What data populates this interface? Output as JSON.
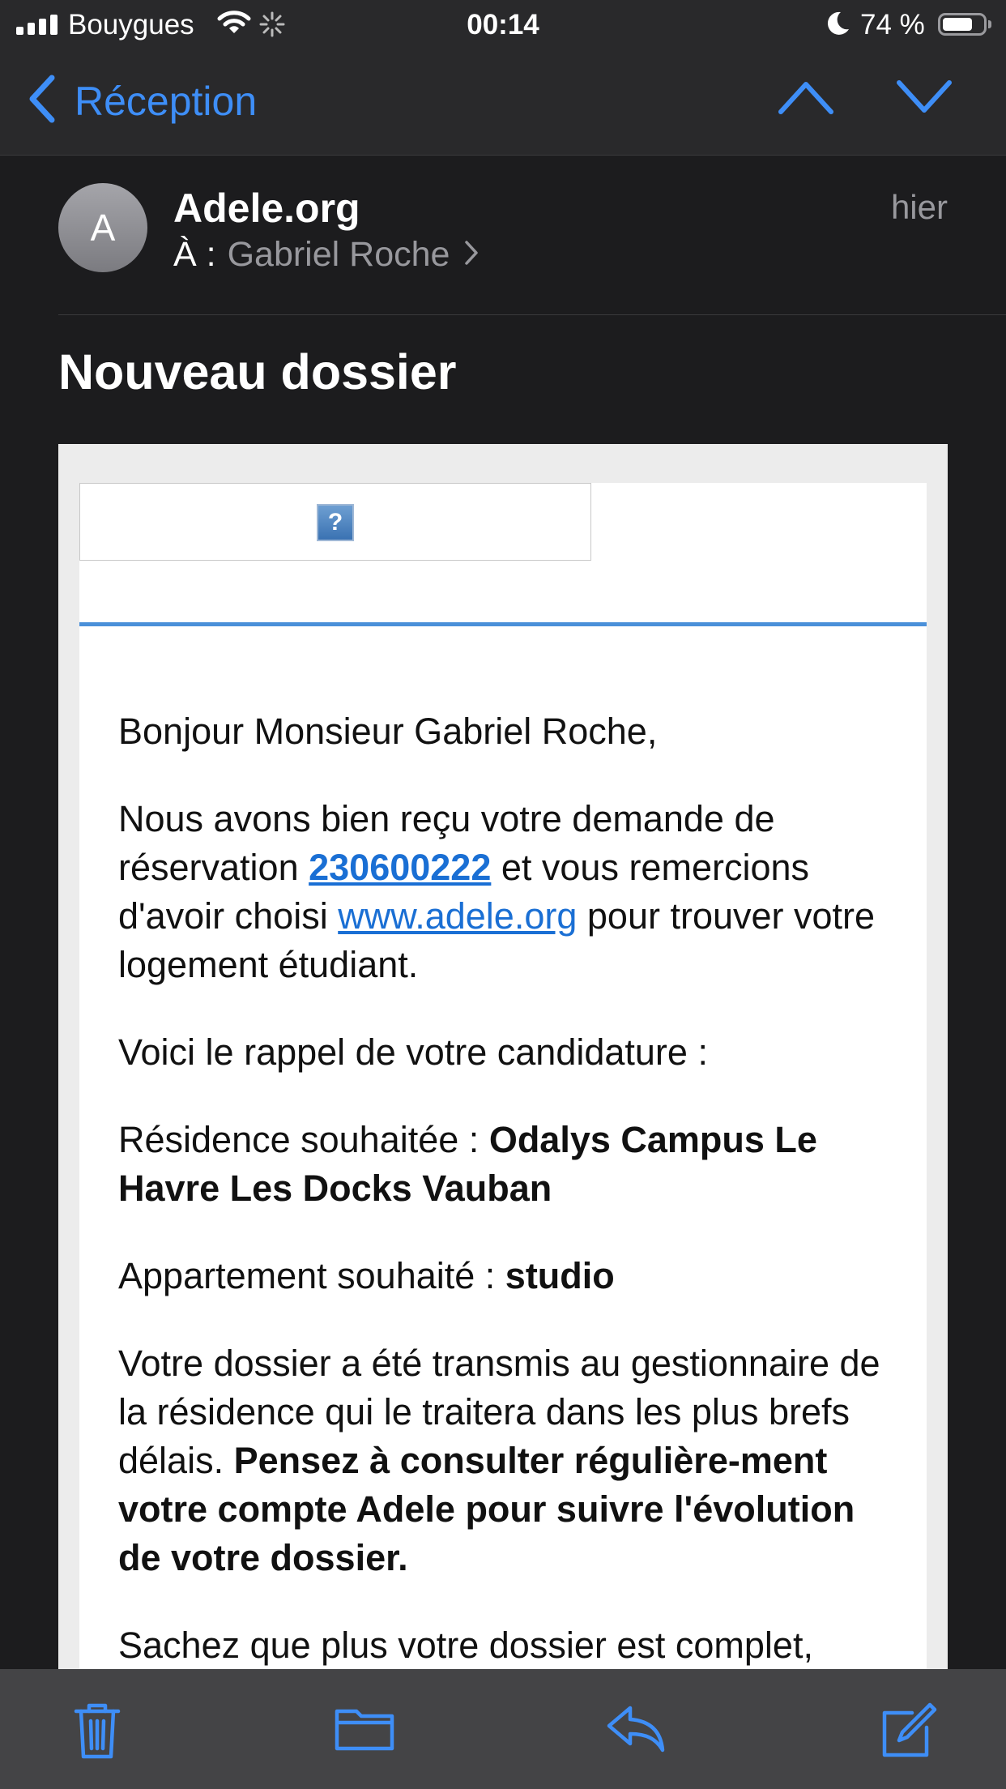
{
  "status_bar": {
    "carrier": "Bouygues",
    "time": "00:14",
    "battery_percent": "74 %",
    "battery_level": 0.74,
    "icons": [
      "signal-icon",
      "wifi-icon",
      "activity-spinner-icon",
      "do-not-disturb-moon-icon",
      "battery-icon"
    ]
  },
  "nav": {
    "back_label": "Réception",
    "icons": [
      "chevron-left-icon",
      "chevron-up-icon",
      "chevron-down-icon"
    ]
  },
  "message": {
    "avatar_initial": "A",
    "sender": "Adele.org",
    "recipient_prefix": "À :",
    "recipient": "Gabriel Roche",
    "date": "hier",
    "subject": "Nouveau dossier"
  },
  "body": {
    "broken_image_glyph": "?",
    "greeting": "Bonjour Monsieur Gabriel Roche,",
    "p1_before": "Nous avons bien reçu votre demande de réservation ",
    "booking_ref": "230600222",
    "p1_middle": " et vous remercions d'avoir choisi ",
    "site_link": "www.adele.org",
    "p1_after": " pour trouver votre logement étudiant.",
    "reminder": "Voici le rappel de votre candidature :",
    "residence_label": "Résidence souhaitée : ",
    "residence_value": "Odalys Campus Le Havre Les Docks Vauban",
    "apartment_label": "Appartement souhaité : ",
    "apartment_value": "studio",
    "p4_before": "Votre dossier a été transmis au gestionnaire de la résidence qui le traitera dans les plus brefs délais. ",
    "p4_bold": "Pensez à consulter régulière-ment votre compte Adele pour suivre l'évolution de votre dossier.",
    "p5": "Sachez que plus votre dossier est complet,"
  },
  "toolbar": {
    "icons": [
      "trash-icon",
      "folder-icon",
      "reply-icon",
      "compose-icon"
    ]
  },
  "colors": {
    "accent": "#3e8ef7",
    "background": "#1c1c1e",
    "bar": "#29292b",
    "link": "#1a6fd4",
    "rule": "#4a90d9"
  }
}
